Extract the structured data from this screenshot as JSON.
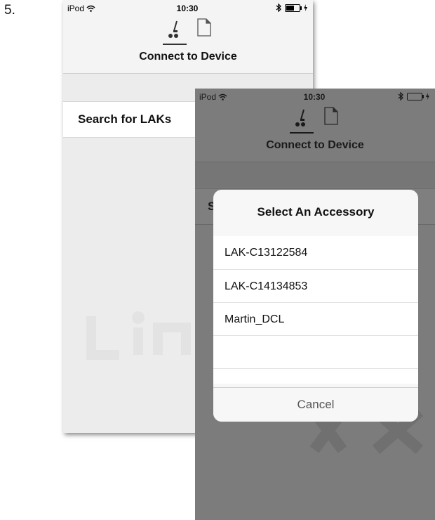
{
  "step_number": "5.",
  "status_bar": {
    "carrier": "iPod",
    "time": "10:30"
  },
  "nav": {
    "title": "Connect to Device",
    "tabs": [
      {
        "icon": "device-icon",
        "selected": true
      },
      {
        "icon": "document-icon",
        "selected": false
      }
    ]
  },
  "screen1": {
    "search_label": "Search for LAKs"
  },
  "screen2": {
    "search_label_visible": "S"
  },
  "alert": {
    "title": "Select An Accessory",
    "items": [
      "LAK-C13122584",
      "LAK-C14134853",
      "Martin_DCL",
      ""
    ],
    "cancel": "Cancel"
  },
  "colors": {
    "dim_overlay": "#7c7c7c",
    "alert_background": "#f7f7f7"
  }
}
